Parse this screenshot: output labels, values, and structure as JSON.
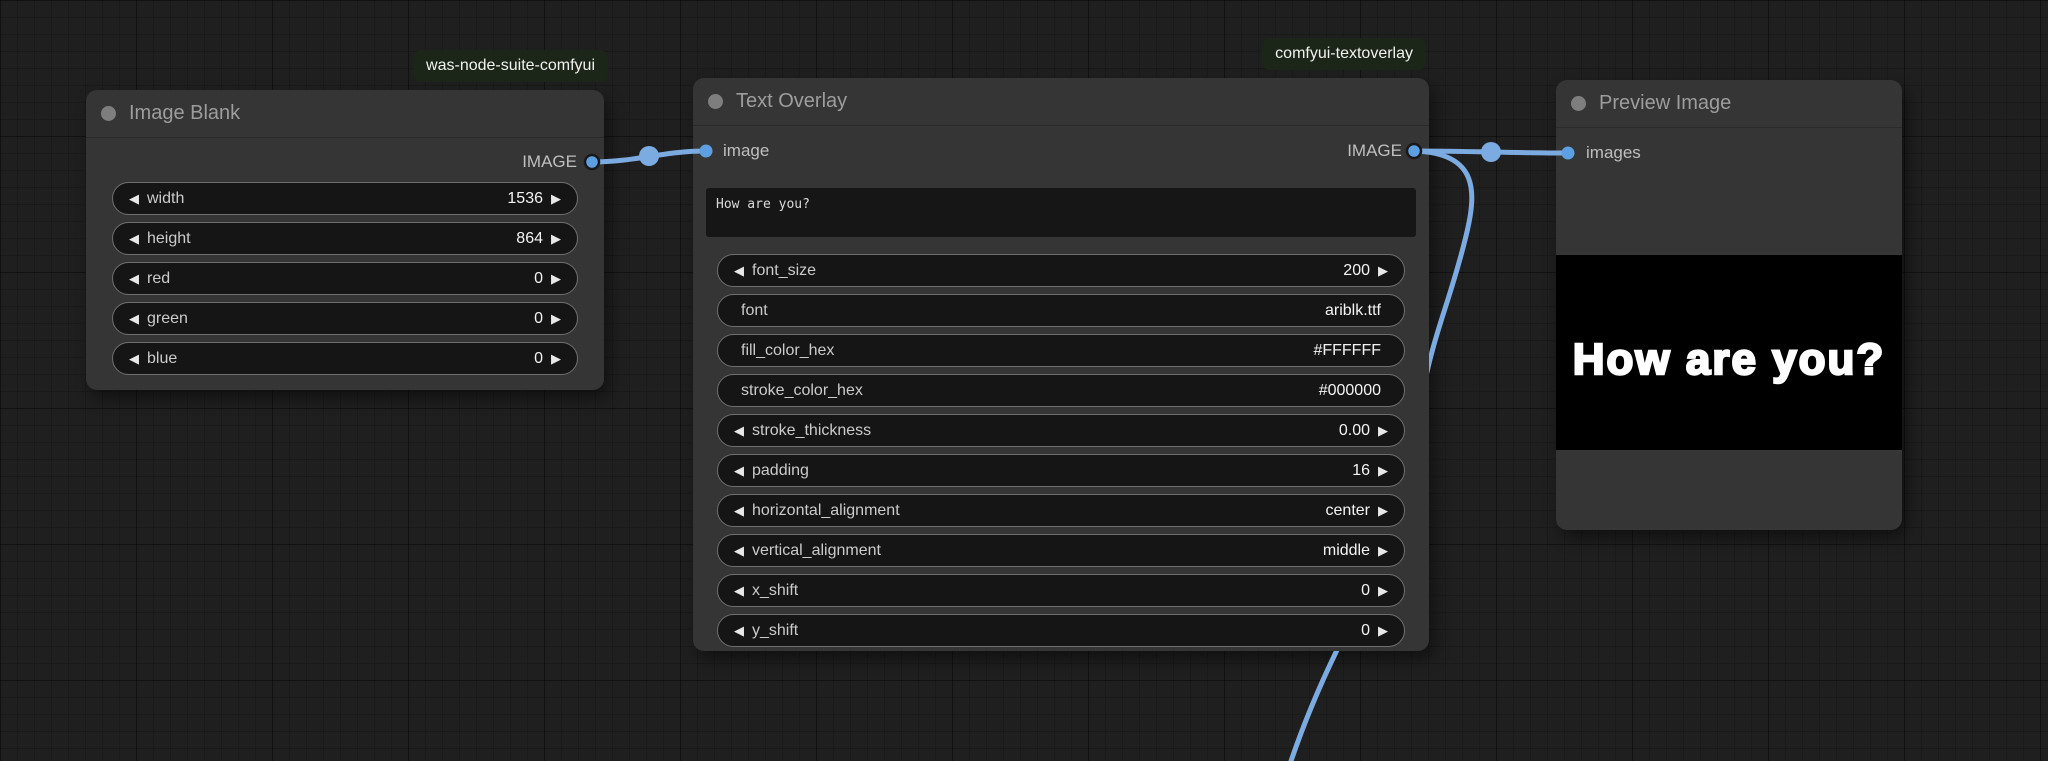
{
  "canvas": {
    "background_color": "#1f1f1f",
    "link_color": "#7babe0",
    "slot_color": "#5d9fe0"
  },
  "icons": {
    "left_arrow": "◀",
    "right_arrow": "▶"
  },
  "badges": [
    {
      "text": "was-node-suite-comfyui",
      "bg_color": "#1b2618"
    },
    {
      "text": "comfyui-textoverlay",
      "bg_color": "#1b2618"
    }
  ],
  "nodes": {
    "image_blank": {
      "title": "Image Blank",
      "outputs": [
        {
          "label": "IMAGE"
        }
      ],
      "widgets": [
        {
          "label": "width",
          "value": "1536"
        },
        {
          "label": "height",
          "value": "864"
        },
        {
          "label": "red",
          "value": "0"
        },
        {
          "label": "green",
          "value": "0"
        },
        {
          "label": "blue",
          "value": "0"
        }
      ]
    },
    "text_overlay": {
      "title": "Text Overlay",
      "inputs": [
        {
          "label": "image"
        }
      ],
      "outputs": [
        {
          "label": "IMAGE"
        }
      ],
      "text_widget": {
        "value": "How are you?"
      },
      "widgets": [
        {
          "label": "font_size",
          "value": "200"
        },
        {
          "label": "font",
          "value": "ariblk.ttf"
        },
        {
          "label": "fill_color_hex",
          "value": "#FFFFFF"
        },
        {
          "label": "stroke_color_hex",
          "value": "#000000"
        },
        {
          "label": "stroke_thickness",
          "value": "0.00"
        },
        {
          "label": "padding",
          "value": "16"
        },
        {
          "label": "horizontal_alignment",
          "value": "center"
        },
        {
          "label": "vertical_alignment",
          "value": "middle"
        },
        {
          "label": "x_shift",
          "value": "0"
        },
        {
          "label": "y_shift",
          "value": "0"
        }
      ]
    },
    "preview_image": {
      "title": "Preview Image",
      "inputs": [
        {
          "label": "images"
        }
      ],
      "preview": {
        "text": "How are you?",
        "bg_color": "#000000",
        "text_color": "#FFFFFF"
      }
    }
  }
}
